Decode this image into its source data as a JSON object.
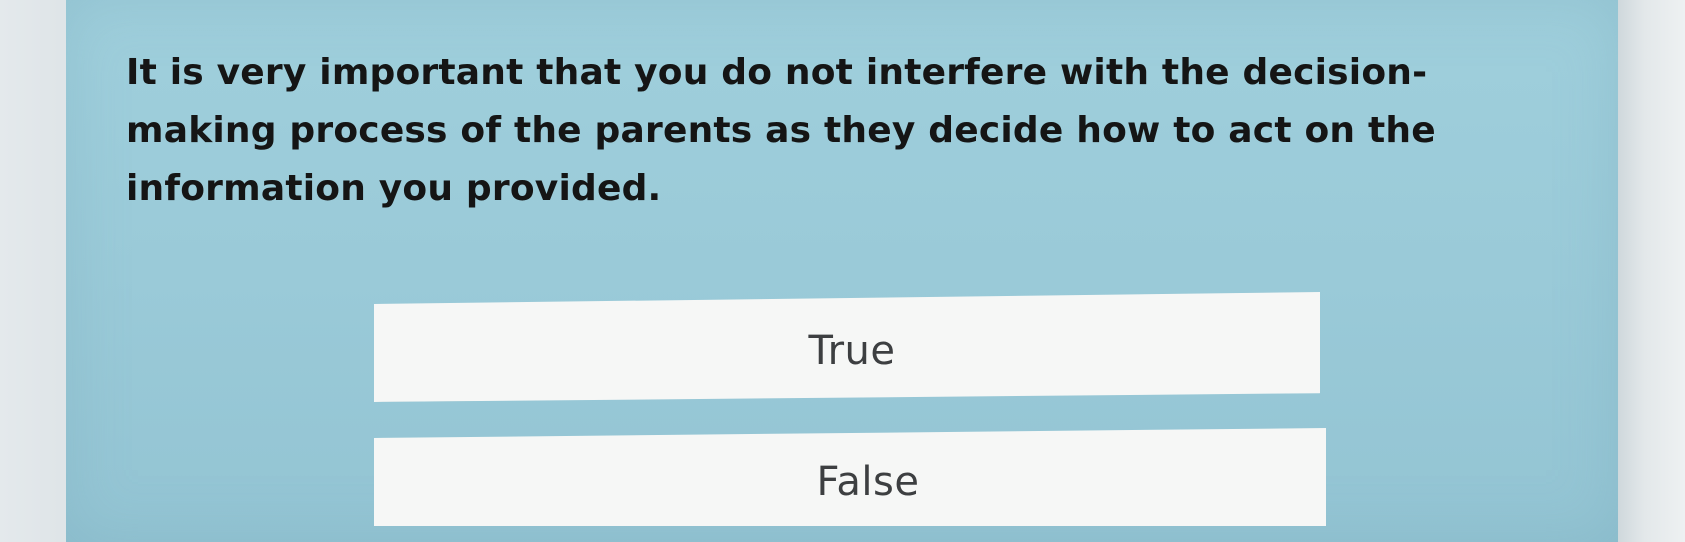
{
  "question": {
    "text": "It is very important that you do not interfere with the decision-making process of the parents as they decide how to act on the information you provided."
  },
  "answers": [
    {
      "label": "True"
    },
    {
      "label": "False"
    }
  ],
  "colors": {
    "panel_background": "#9acad8",
    "option_background": "#f6f7f6",
    "question_text": "#151515",
    "option_text": "#3d3f41"
  }
}
